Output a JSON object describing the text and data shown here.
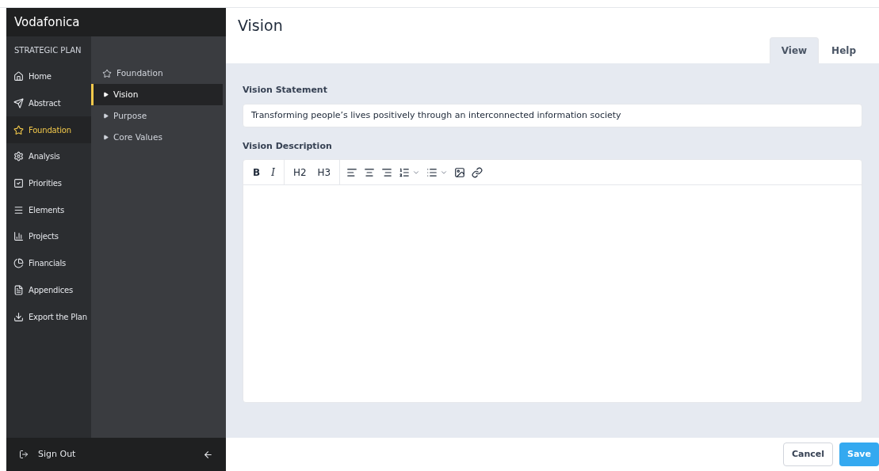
{
  "app": {
    "title": "Vodafonica"
  },
  "sidebar": {
    "section": "STRATEGIC PLAN",
    "items": [
      {
        "label": "Home",
        "selected": false
      },
      {
        "label": "Abstract",
        "selected": false
      },
      {
        "label": "Foundation",
        "selected": true
      },
      {
        "label": "Analysis",
        "selected": false
      },
      {
        "label": "Priorities",
        "selected": false
      },
      {
        "label": "Elements",
        "selected": false
      },
      {
        "label": "Projects",
        "selected": false
      },
      {
        "label": "Financials",
        "selected": false
      },
      {
        "label": "Appendices",
        "selected": false
      },
      {
        "label": "Export the Plan",
        "selected": false
      }
    ],
    "sign_out": "Sign Out"
  },
  "subnav": {
    "title": "Foundation",
    "items": [
      {
        "label": "Vision",
        "selected": true
      },
      {
        "label": "Purpose",
        "selected": false
      },
      {
        "label": "Core Values",
        "selected": false
      }
    ]
  },
  "page": {
    "title": "Vision",
    "tabs": [
      {
        "label": "View",
        "selected": true
      },
      {
        "label": "Help",
        "selected": false
      }
    ]
  },
  "form": {
    "statement_label": "Vision Statement",
    "statement_value": "Transforming people’s lives positively through an interconnected information society",
    "description_label": "Vision Description",
    "toolbar": [
      "B",
      "I",
      "H2",
      "H3"
    ]
  },
  "footer": {
    "buttons": [
      "Cancel",
      "Save"
    ]
  }
}
